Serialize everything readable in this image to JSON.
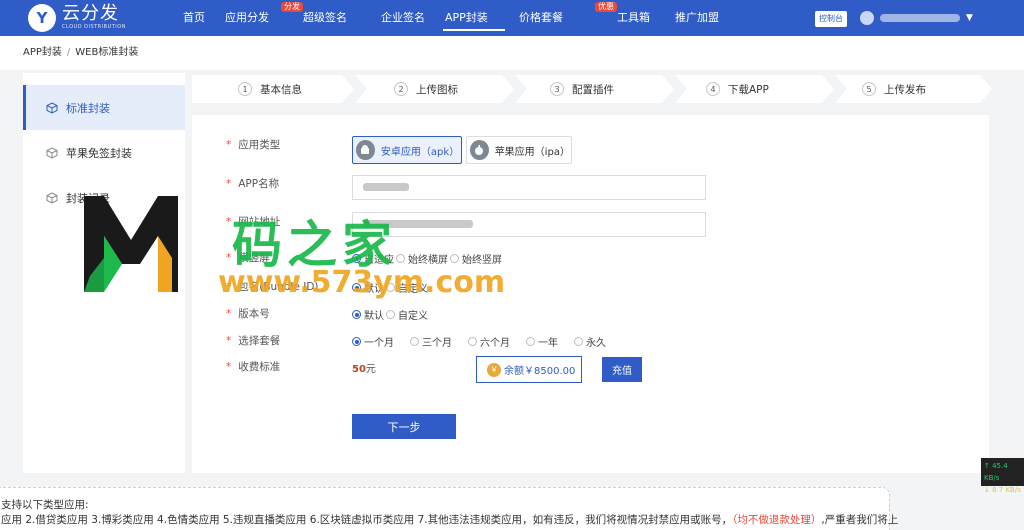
{
  "brand": {
    "name": "云分发",
    "subtitle": "CLOUD DISTRIBUTION",
    "letter": "Y"
  },
  "nav": {
    "items": [
      {
        "label": "首页"
      },
      {
        "label": "应用分发",
        "badge": "分发"
      },
      {
        "label": "超级签名"
      },
      {
        "label": "企业签名"
      },
      {
        "label": "APP封装"
      },
      {
        "label": "价格套餐",
        "badge": "优惠"
      },
      {
        "label": "工具箱"
      },
      {
        "label": "推广加盟"
      }
    ],
    "console_label": "控制台"
  },
  "breadcrumb": {
    "root": "APP封装",
    "sep": "/",
    "current": "WEB标准封装"
  },
  "sidebar": {
    "items": [
      {
        "label": "标准封装"
      },
      {
        "label": "苹果免签封装"
      },
      {
        "label": "封装记录"
      }
    ]
  },
  "steps": [
    {
      "num": "1",
      "label": "基本信息"
    },
    {
      "num": "2",
      "label": "上传图标"
    },
    {
      "num": "3",
      "label": "配置插件"
    },
    {
      "num": "4",
      "label": "下载APP"
    },
    {
      "num": "5",
      "label": "上传发布"
    }
  ],
  "form": {
    "app_type": {
      "label": "应用类型",
      "android": "安卓应用（apk）",
      "ios": "苹果应用（ipa）"
    },
    "app_name": {
      "label": "APP名称"
    },
    "url": {
      "label": "网站地址"
    },
    "orientation": {
      "label": "横竖屏",
      "options": [
        "自适应",
        "始终横屏",
        "始终竖屏"
      ]
    },
    "bundle": {
      "label": "包名(Bundle ID)",
      "options": [
        "默认",
        "自定义"
      ]
    },
    "version": {
      "label": "版本号",
      "options": [
        "默认",
        "自定义"
      ]
    },
    "plan": {
      "label": "选择套餐",
      "options": [
        "一个月",
        "三个月",
        "六个月",
        "一年",
        "永久"
      ]
    },
    "fee": {
      "label": "收费标准",
      "amount": "50",
      "unit": "元"
    },
    "balance": "余额￥8500.00",
    "recharge_label": "充值",
    "next_label": "下一步"
  },
  "notice": {
    "line1": "支持以下类型应用:",
    "line2_prefix": "应用 2.借贷类应用 3.博彩类应用 4.色情类应用 5.违规直播类应用 6.区块链虚拟币类应用 7.其他违法违规类应用，如有违反，我们将视情况封禁应用或账号，",
    "line2_warn": "（均不做退款处理）",
    "line2_suffix": ",严重者我们将上"
  },
  "speed": {
    "up": "↑ 45.4 KB/s",
    "down": "↓ 8.7 KB/s"
  },
  "watermark": {
    "title": "码之家",
    "url": "www.573ym.com"
  },
  "colors": {
    "primary": "#2f5cc6",
    "danger": "#e84a3c",
    "watermark_green": "#18b84a",
    "watermark_orange": "#f0a522"
  }
}
